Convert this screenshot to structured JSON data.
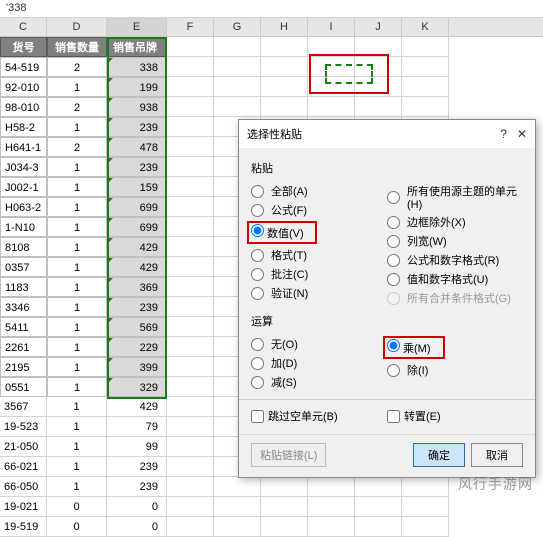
{
  "formula_bar": "'338",
  "columns": [
    "C",
    "D",
    "E",
    "F",
    "G",
    "H",
    "I",
    "J",
    "K"
  ],
  "headers": {
    "c": "货号",
    "d": "销售数量",
    "e": "销售吊牌额"
  },
  "rows": [
    {
      "c": "54-519",
      "d": "2",
      "e": "338"
    },
    {
      "c": "92-010",
      "d": "1",
      "e": "199"
    },
    {
      "c": "98-010",
      "d": "2",
      "e": "938"
    },
    {
      "c": "H58-2",
      "d": "1",
      "e": "239"
    },
    {
      "c": "H641-1",
      "d": "2",
      "e": "478"
    },
    {
      "c": "J034-3",
      "d": "1",
      "e": "239"
    },
    {
      "c": "J002-1",
      "d": "1",
      "e": "159"
    },
    {
      "c": "H063-2",
      "d": "1",
      "e": "699"
    },
    {
      "c": "1-N10",
      "d": "1",
      "e": "699"
    },
    {
      "c": "8108",
      "d": "1",
      "e": "429"
    },
    {
      "c": "0357",
      "d": "1",
      "e": "429"
    },
    {
      "c": "1183",
      "d": "1",
      "e": "369"
    },
    {
      "c": "3346",
      "d": "1",
      "e": "239"
    },
    {
      "c": "5411",
      "d": "1",
      "e": "569"
    },
    {
      "c": "2261",
      "d": "1",
      "e": "229"
    },
    {
      "c": "2195",
      "d": "1",
      "e": "399"
    },
    {
      "c": "0551",
      "d": "1",
      "e": "329"
    },
    {
      "c": "3567",
      "d": "1",
      "e": "429"
    },
    {
      "c": "19-523",
      "d": "1",
      "e": "79"
    },
    {
      "c": "21-050",
      "d": "1",
      "e": "99"
    },
    {
      "c": "66-021",
      "d": "1",
      "e": "239"
    },
    {
      "c": "66-050",
      "d": "1",
      "e": "239"
    },
    {
      "c": "19-021",
      "d": "0",
      "e": "0"
    },
    {
      "c": "19-519",
      "d": "0",
      "e": "0"
    }
  ],
  "dialog": {
    "title": "选择性粘贴",
    "help": "?",
    "close": "✕",
    "paste_label": "粘贴",
    "paste_left": [
      {
        "label": "全部(A)",
        "sel": false
      },
      {
        "label": "公式(F)",
        "sel": false
      },
      {
        "label": "数值(V)",
        "sel": true,
        "red": true
      },
      {
        "label": "格式(T)",
        "sel": false
      },
      {
        "label": "批注(C)",
        "sel": false
      },
      {
        "label": "验证(N)",
        "sel": false
      }
    ],
    "paste_right": [
      {
        "label": "所有使用源主题的单元(H)",
        "sel": false
      },
      {
        "label": "边框除外(X)",
        "sel": false
      },
      {
        "label": "列宽(W)",
        "sel": false
      },
      {
        "label": "公式和数字格式(R)",
        "sel": false
      },
      {
        "label": "值和数字格式(U)",
        "sel": false
      },
      {
        "label": "所有合并条件格式(G)",
        "sel": false,
        "disabled": true
      }
    ],
    "op_label": "运算",
    "op_left": [
      {
        "label": "无(O)",
        "sel": false
      },
      {
        "label": "加(D)",
        "sel": false
      },
      {
        "label": "减(S)",
        "sel": false
      }
    ],
    "op_right": [
      {
        "label": "乘(M)",
        "sel": true,
        "red": true
      },
      {
        "label": "除(I)",
        "sel": false
      }
    ],
    "skip_blanks": "跳过空单元(B)",
    "transpose": "转置(E)",
    "paste_link": "粘贴链接(L)",
    "ok": "确定",
    "cancel": "取消"
  },
  "watermark": "风行手游网"
}
